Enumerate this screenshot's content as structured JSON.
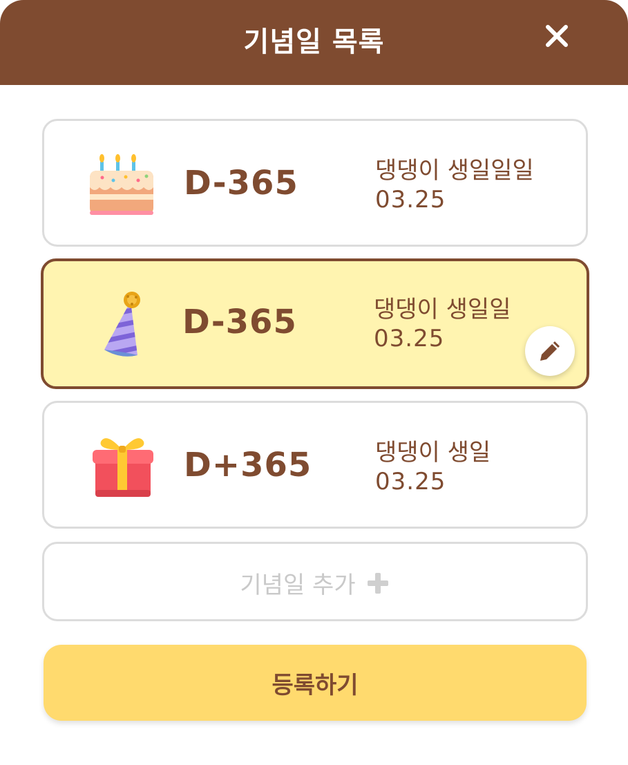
{
  "header": {
    "title": "기념일 목록",
    "close_icon": "close-icon"
  },
  "anniversaries": [
    {
      "icon": "cake-icon",
      "dday": "D-365",
      "name": "댕댕이 생일일일",
      "date": "03.25",
      "selected": false
    },
    {
      "icon": "party-hat-icon",
      "dday": "D-365",
      "name": "댕댕이 생일일",
      "date": "03.25",
      "selected": true,
      "edit_icon": "pencil-icon"
    },
    {
      "icon": "gift-icon",
      "dday": "D+365",
      "name": "댕댕이 생일",
      "date": "03.25",
      "selected": false
    }
  ],
  "add_item": {
    "label": "기념일 추가",
    "icon": "plus-icon"
  },
  "submit": {
    "label": "등록하기"
  },
  "colors": {
    "brand_brown": "#7f4b30",
    "selected_bg": "#fff4b0",
    "submit_bg": "#ffda6e",
    "border_gray": "#dcdcdc",
    "placeholder_gray": "#c9c9c9"
  }
}
